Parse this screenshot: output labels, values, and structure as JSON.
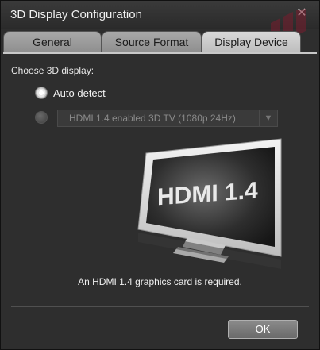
{
  "window": {
    "title": "3D Display Configuration",
    "close_icon": "close-icon"
  },
  "tabs": [
    {
      "label": "General",
      "selected": false
    },
    {
      "label": "Source Format",
      "selected": false
    },
    {
      "label": "Display Device",
      "selected": true
    }
  ],
  "display_device": {
    "choose_label": "Choose 3D display:",
    "options": {
      "auto_label": "Auto detect",
      "auto_selected": true,
      "manual_selected": false,
      "manual_select_value": "HDMI 1.4 enabled 3D TV (1080p 24Hz)",
      "manual_enabled": false
    },
    "illustration_text": "HDMI 1.4",
    "note": "An HDMI 1.4 graphics card is required."
  },
  "footer": {
    "ok_label": "OK"
  },
  "colors": {
    "background": "#2e2e2e",
    "tab_active": "#cfcfcf",
    "tab_inactive": "#9a9a9a",
    "text": "#e6e6e6"
  }
}
